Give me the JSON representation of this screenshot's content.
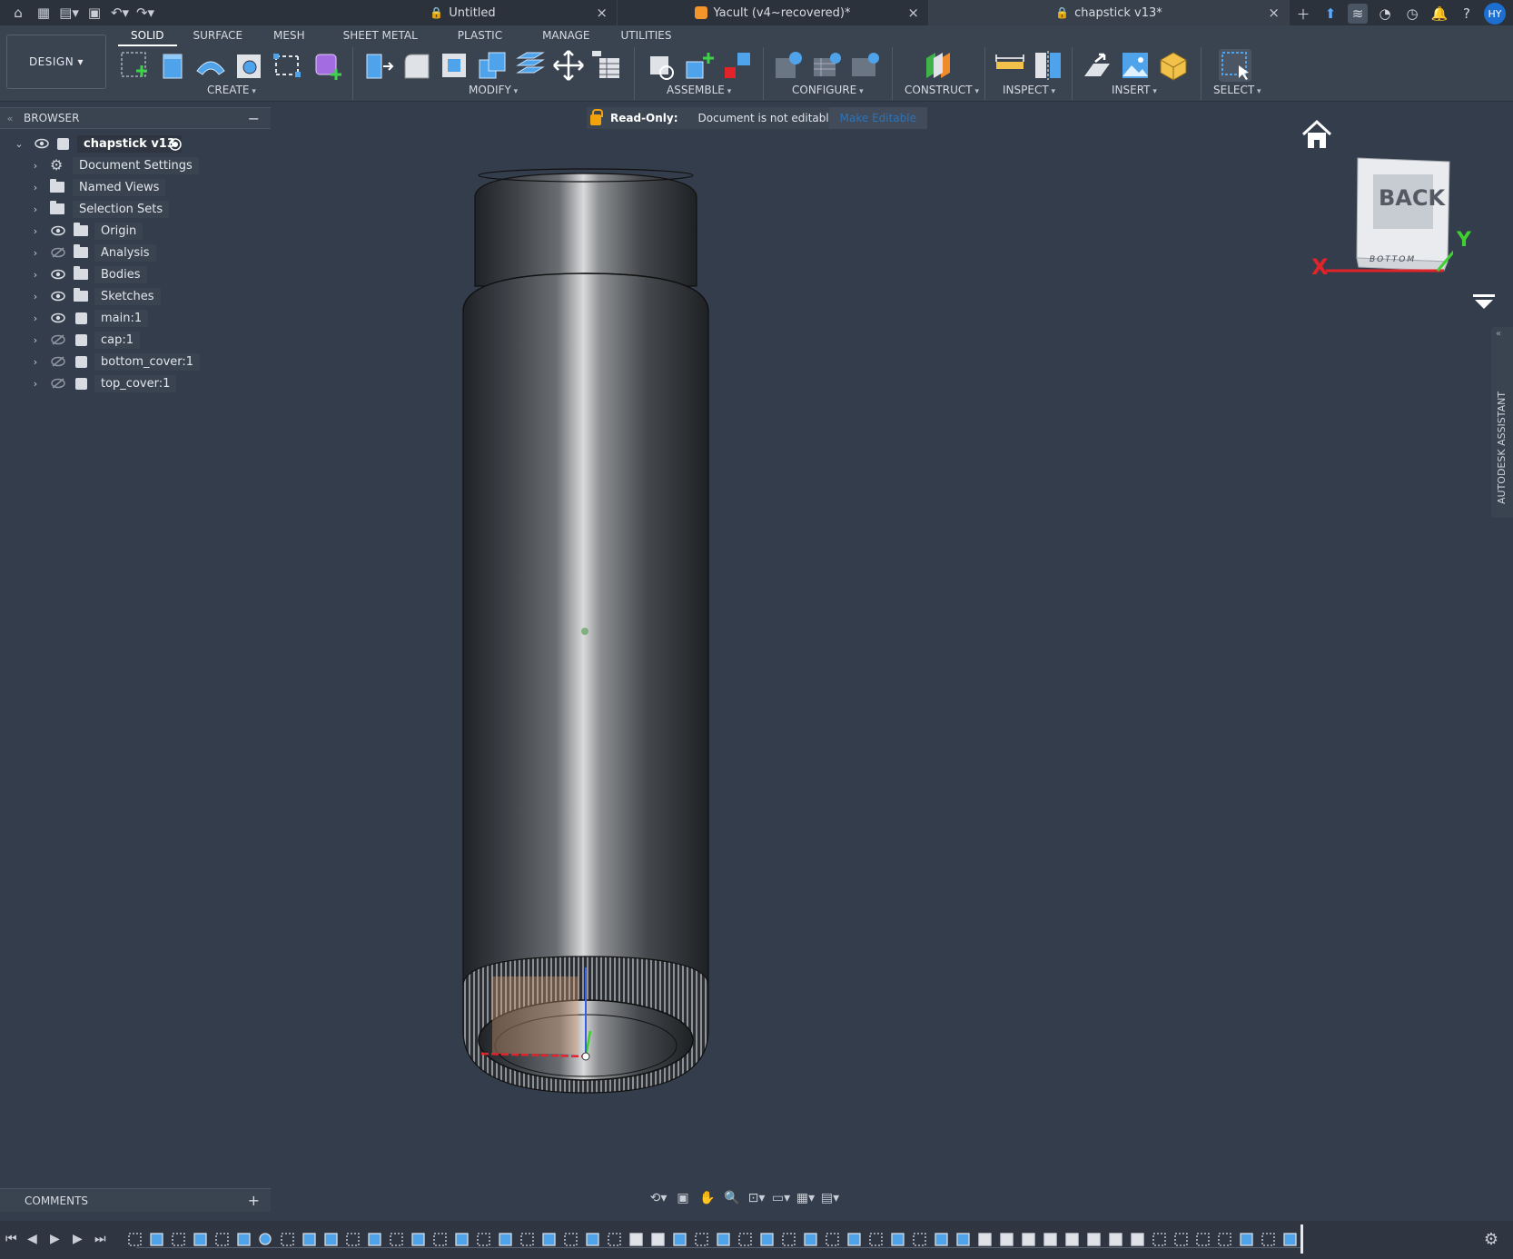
{
  "titlebar": {
    "icons": [
      "home-icon",
      "grid-icon",
      "file-icon",
      "save-icon",
      "undo-icon",
      "redo-icon"
    ],
    "tabs": [
      {
        "label": "Untitled",
        "locked": true
      },
      {
        "label": "Yacult (v4~recovered)*",
        "locked": false
      },
      {
        "label": "chapstick v13*",
        "locked": true
      }
    ],
    "close_glyph": "×",
    "right_icons": [
      "plus-icon",
      "upload-icon",
      "extensions-icon",
      "online-icon",
      "clock-icon",
      "bell-icon",
      "help-icon"
    ],
    "user_initials": "HY"
  },
  "ribbon": {
    "workspace": "DESIGN",
    "tabs": [
      "SOLID",
      "SURFACE",
      "MESH",
      "SHEET METAL",
      "PLASTIC",
      "MANAGE",
      "UTILITIES"
    ],
    "groups": [
      "CREATE",
      "MODIFY",
      "ASSEMBLE",
      "CONFIGURE",
      "CONSTRUCT",
      "INSPECT",
      "INSERT",
      "SELECT"
    ]
  },
  "browser": {
    "title": "BROWSER",
    "root": "chapstick v13",
    "items": [
      {
        "label": "Document Settings",
        "kind": "settings",
        "eye": "none"
      },
      {
        "label": "Named Views",
        "kind": "folder",
        "eye": "none"
      },
      {
        "label": "Selection Sets",
        "kind": "folder",
        "eye": "none"
      },
      {
        "label": "Origin",
        "kind": "folder",
        "eye": "visible"
      },
      {
        "label": "Analysis",
        "kind": "folder",
        "eye": "hidden"
      },
      {
        "label": "Bodies",
        "kind": "folder",
        "eye": "visible"
      },
      {
        "label": "Sketches",
        "kind": "folder",
        "eye": "visible"
      },
      {
        "label": "main:1",
        "kind": "component",
        "eye": "visible"
      },
      {
        "label": "cap:1",
        "kind": "component",
        "eye": "hidden"
      },
      {
        "label": "bottom_cover:1",
        "kind": "component",
        "eye": "hidden"
      },
      {
        "label": "top_cover:1",
        "kind": "component",
        "eye": "hidden"
      }
    ]
  },
  "readonly": {
    "label": "Read-Only:",
    "message": "Document is not editable",
    "action": "Make Editable"
  },
  "viewcube": {
    "face": "BACK",
    "bottom": "BOTTOM",
    "axis_x": "X",
    "axis_y": "Y"
  },
  "assistant": {
    "label": "AUTODESK ASSISTANT"
  },
  "comments": {
    "label": "COMMENTS",
    "add": "+"
  },
  "colors": {
    "accent": "#1c6fd1",
    "lock": "#f2a20c",
    "axis_x": "#e0242a",
    "axis_y": "#3ed12f",
    "link": "#2d73b8"
  }
}
